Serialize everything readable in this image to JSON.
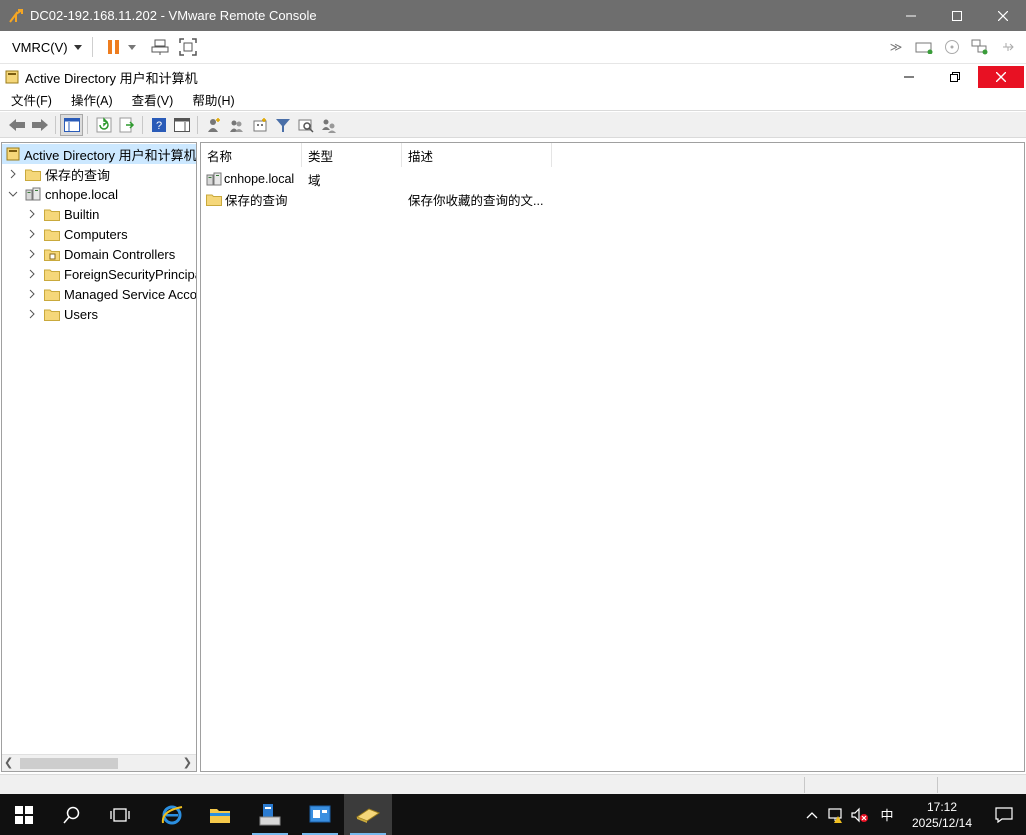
{
  "vmrc": {
    "window_title": "DC02-192.168.11.202 - VMware Remote Console",
    "menu_label": "VMRC(V)"
  },
  "aduc": {
    "window_title": "Active Directory 用户和计算机",
    "menu": [
      "文件(F)",
      "操作(A)",
      "查看(V)",
      "帮助(H)"
    ]
  },
  "tree": {
    "root": "Active Directory 用户和计算机",
    "saved_queries": "保存的查询",
    "domain": "cnhope.local",
    "children": [
      "Builtin",
      "Computers",
      "Domain Controllers",
      "ForeignSecurityPrincipals",
      "Managed Service Accounts",
      "Users"
    ]
  },
  "list": {
    "columns": [
      "名称",
      "类型",
      "描述"
    ],
    "rows": [
      {
        "name": "cnhope.local",
        "type": "域",
        "desc": ""
      },
      {
        "name": "保存的查询",
        "type": "",
        "desc": "保存你收藏的查询的文..."
      }
    ]
  },
  "taskbar": {
    "ime": "中",
    "time": "17:12",
    "date": "2025/12/14"
  },
  "colors": {
    "vm_titlebar": "#6e6e6e",
    "selection": "#cce8ff",
    "close_red": "#e81123",
    "folder": "#f5d77a",
    "pause_orange": "#ee7d1f"
  }
}
